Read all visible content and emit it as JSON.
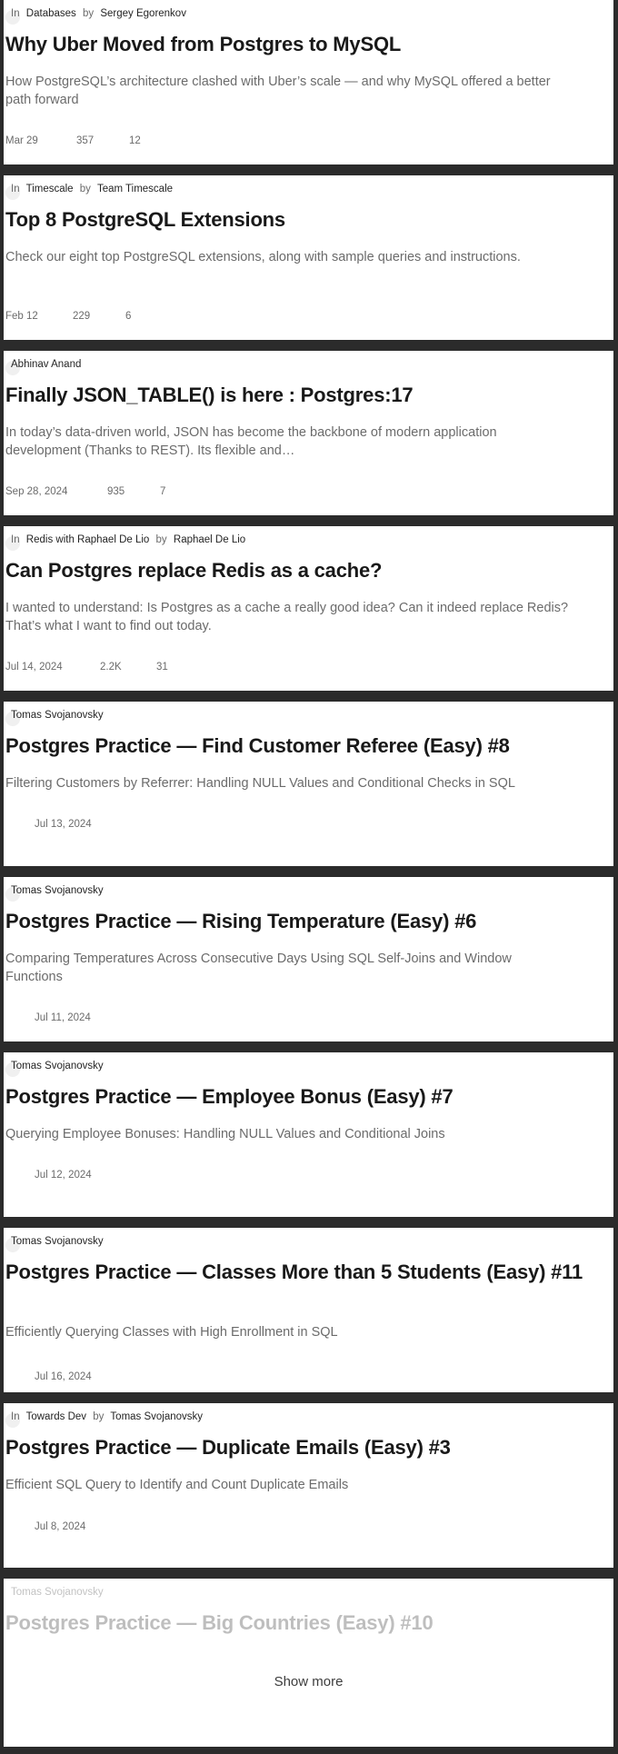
{
  "articles": [
    {
      "in_prefix": "In",
      "publication": "Databases",
      "by_prefix": "by",
      "author": "Sergey Egorenkov",
      "title": "Why Uber Moved from Postgres to MySQL",
      "subtitle": "How PostgreSQL’s architecture clashed with Uber’s scale — and why MySQL offered a better path forward",
      "date": "Mar 29",
      "claps": "357",
      "responses": "12"
    },
    {
      "in_prefix": "In",
      "publication": "Timescale",
      "by_prefix": "by",
      "author": "Team Timescale",
      "title": "Top 8 PostgreSQL Extensions",
      "subtitle": "Check our eight top PostgreSQL extensions, along with sample queries and instructions.",
      "date": "Feb 12",
      "claps": "229",
      "responses": "6"
    },
    {
      "author": "Abhinav Anand",
      "title": "Finally JSON_TABLE() is here : Postgres:17",
      "subtitle": "In today’s data-driven world, JSON has become the backbone of modern application development (Thanks to REST). Its flexible and…",
      "date": "Sep 28, 2024",
      "claps": "935",
      "responses": "7"
    },
    {
      "in_prefix": "In",
      "publication": "Redis with Raphael De Lio",
      "by_prefix": "by",
      "author": "Raphael De Lio",
      "title": "Can Postgres replace Redis as a cache?",
      "subtitle": "I wanted to understand: Is Postgres as a cache a really good idea? Can it indeed replace Redis? That’s what I want to find out today.",
      "date": "Jul 14, 2024",
      "claps": "2.2K",
      "responses": "31"
    },
    {
      "author": "Tomas Svojanovsky",
      "title": "Postgres Practice — Find Customer Referee (Easy) #8",
      "subtitle": "Filtering Customers by Referrer: Handling NULL Values and Conditional Checks in SQL",
      "date": "Jul 13, 2024"
    },
    {
      "author": "Tomas Svojanovsky",
      "title": "Postgres Practice — Rising Temperature (Easy) #6",
      "subtitle": "Comparing Temperatures Across Consecutive Days Using SQL Self-Joins and Window Functions",
      "date": "Jul 11, 2024"
    },
    {
      "author": "Tomas Svojanovsky",
      "title": "Postgres Practice — Employee Bonus (Easy) #7",
      "subtitle": "Querying Employee Bonuses: Handling NULL Values and Conditional Joins",
      "date": "Jul 12, 2024"
    },
    {
      "author": "Tomas Svojanovsky",
      "title": "Postgres Practice — Classes More than 5 Students (Easy) #11",
      "subtitle": "Efficiently Querying Classes with High Enrollment in SQL",
      "date": "Jul 16, 2024"
    },
    {
      "in_prefix": "In",
      "publication": "Towards Dev",
      "by_prefix": "by",
      "author": "Tomas Svojanovsky",
      "title": "Postgres Practice — Duplicate Emails (Easy) #3",
      "subtitle": "Efficient SQL Query to Identify and Count Duplicate Emails",
      "date": "Jul 8, 2024"
    },
    {
      "author": "Tomas Svojanovsky",
      "title": "Postgres Practice — Big Countries (Easy) #10"
    }
  ],
  "show_more_label": "Show more"
}
